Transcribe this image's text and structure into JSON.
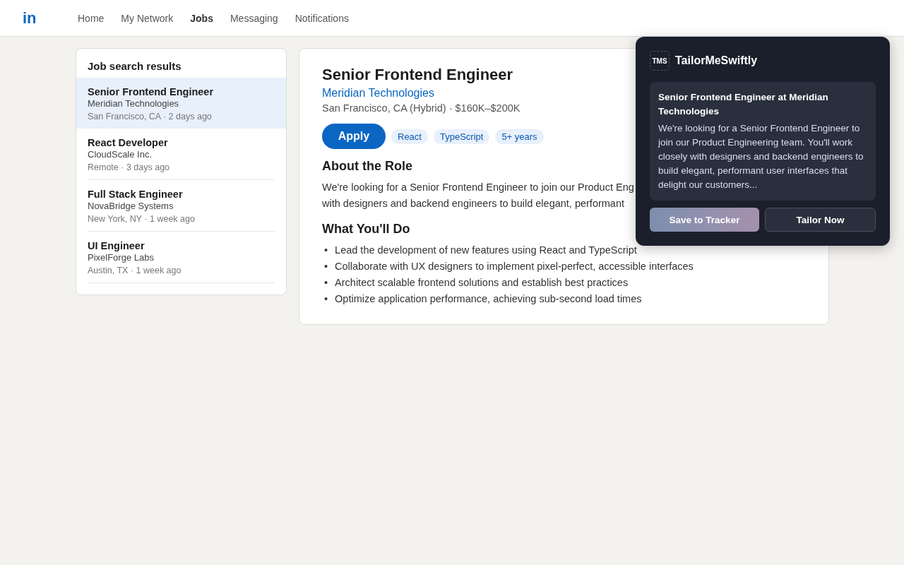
{
  "nav": {
    "logo": "in",
    "items": [
      {
        "label": "Home",
        "selected": false
      },
      {
        "label": "My Network",
        "selected": false
      },
      {
        "label": "Jobs",
        "selected": true
      },
      {
        "label": "Messaging",
        "selected": false
      },
      {
        "label": "Notifications",
        "selected": false
      }
    ]
  },
  "results": {
    "title": "Job search results",
    "jobs": [
      {
        "title": "Senior Frontend Engineer",
        "company": "Meridian Technologies",
        "meta": "San Francisco, CA · 2 days ago",
        "selected": true
      },
      {
        "title": "React Developer",
        "company": "CloudScale Inc.",
        "meta": "Remote · 3 days ago",
        "selected": false
      },
      {
        "title": "Full Stack Engineer",
        "company": "NovaBridge Systems",
        "meta": "New York, NY · 1 week ago",
        "selected": false
      },
      {
        "title": "UI Engineer",
        "company": "PixelForge Labs",
        "meta": "Austin, TX · 1 week ago",
        "selected": false
      }
    ]
  },
  "detail": {
    "title": "Senior Frontend Engineer",
    "company": "Meridian Technologies",
    "meta": "San Francisco, CA (Hybrid) · $160K–$200K",
    "apply": "Apply",
    "tags": [
      "React",
      "TypeScript",
      "5+ years"
    ],
    "sections": [
      {
        "kind": "paragraph",
        "heading": "About the Role",
        "lines": [
          "We're looking for a Senior Frontend Engineer to join our Product Eng",
          "with designers and backend engineers to build elegant, performant"
        ]
      },
      {
        "kind": "bullets",
        "heading": "What You'll Do",
        "bullet": "•",
        "lines": [
          "Lead the development of new features using React and TypeScript",
          "Collaborate with UX designers to implement pixel-perfect, accessible interfaces",
          "Architect scalable frontend solutions and establish best practices",
          "Optimize application performance, achieving sub-second load times"
        ]
      }
    ]
  },
  "extension": {
    "logo": "TMS",
    "name": "TailorMeSwiftly",
    "card_title": "Senior Frontend Engineer at Meridian Technologies",
    "card_text": "We're looking for a Senior Frontend Engineer to join our Product Engineering team. You'll work closely with designers and backend engineers to build elegant, performant user interfaces that delight our customers...",
    "buttons": [
      {
        "kind": "gradient",
        "label": "Save to Tracker"
      },
      {
        "kind": "outline",
        "label": "Tailor Now"
      }
    ]
  }
}
